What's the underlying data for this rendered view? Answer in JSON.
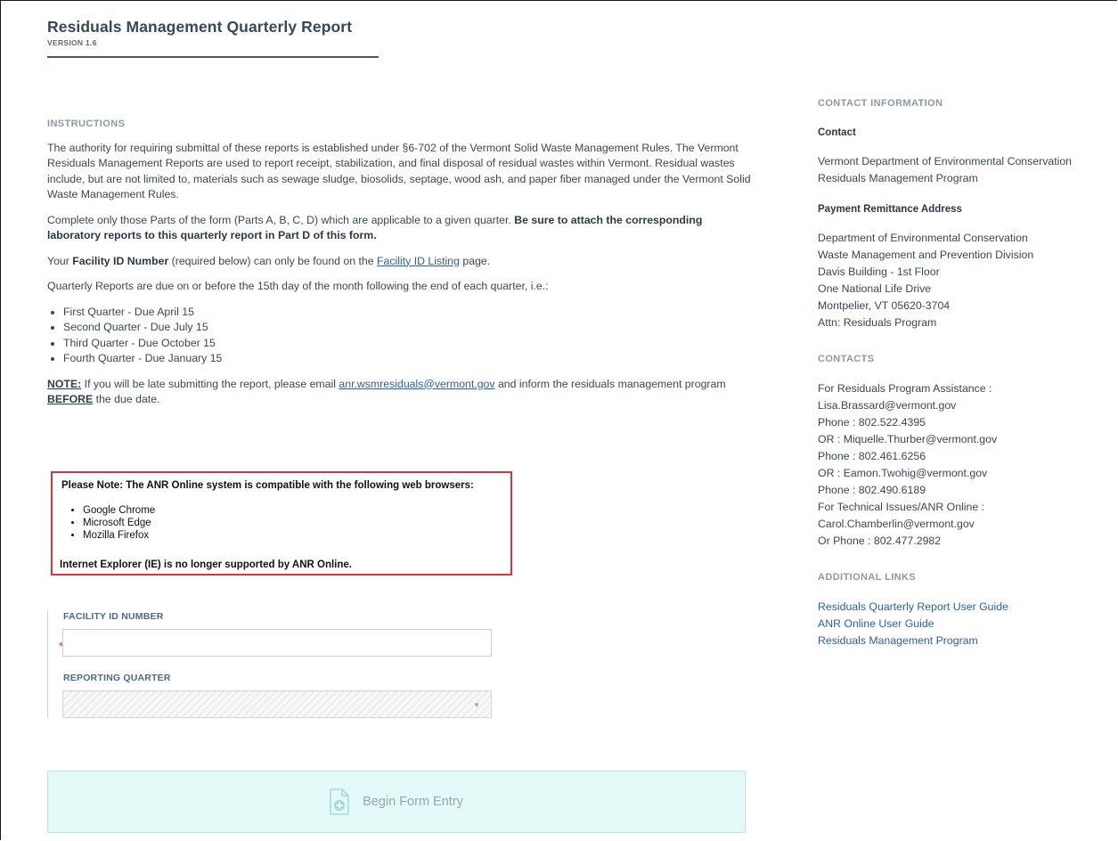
{
  "header": {
    "title": "Residuals Management Quarterly Report",
    "version": "VERSION 1.6"
  },
  "instructions": {
    "heading": "INSTRUCTIONS",
    "para1": "The authority for requiring submittal of these reports is established under §6-702 of the Vermont Solid Waste Management Rules. The Vermont Residuals Management Reports are used to report receipt, stabilization, and final disposal of residual wastes within Vermont. Residual wastes include, but are not limited to, materials such as sewage sludge, biosolids, septage, wood ash, and paper fiber managed under the Vermont Solid Waste Management Rules.",
    "para2_text": "Complete only those Parts of the form (Parts A, B, C, D) which are applicable to a given quarter. ",
    "para2_bold": "Be sure to attach the corresponding laboratory reports to this quarterly report in Part D of this form.",
    "para3_pre": "Your ",
    "para3_bold": "Facility ID Number",
    "para3_mid": " (required below) can only be found on the ",
    "para3_link": "Facility ID Listing",
    "para3_post": " page.",
    "para4": "Quarterly Reports are due on or before the 15th day of the month following the end of each quarter, i.e.:",
    "due_dates": [
      "First Quarter - Due April 15",
      "Second Quarter - Due July 15",
      "Third Quarter - Due October 15",
      "Fourth Quarter - Due January 15"
    ],
    "note_label": "NOTE:",
    "note_pre": " If you will be late submitting the report, please email ",
    "note_email": "anr.wsmresiduals@vermont.gov",
    "note_mid": " and inform the residuals management program ",
    "note_before": "BEFORE",
    "note_post": " the due date."
  },
  "browser_notice": {
    "title": "Please Note: The ANR Online system is compatible with the following web browsers:",
    "browsers": [
      "Google Chrome",
      "Microsoft Edge",
      "Mozilla Firefox"
    ],
    "footer": "Internet Explorer (IE) is no longer supported by ANR Online."
  },
  "form": {
    "facility_label": "FACILITY ID NUMBER",
    "facility_value": "",
    "required_mark": "*",
    "quarter_label": "REPORTING QUARTER",
    "begin_label": "Begin Form Entry"
  },
  "sidebar": {
    "contact_info_heading": "CONTACT INFORMATION",
    "contact_heading": "Contact",
    "contact_lines": [
      "Vermont Department of Environmental Conservation",
      "Residuals Management Program"
    ],
    "payment_heading": "Payment Remittance Address",
    "payment_lines": [
      "Department of Environmental Conservation",
      "Waste Management and Prevention Division",
      "Davis Building - 1st Floor",
      "One National Life Drive",
      "Montpelier, VT 05620-3704",
      "Attn: Residuals Program"
    ],
    "contacts_heading": "CONTACTS",
    "contacts_lines": [
      "For Residuals Program Assistance :",
      "Lisa.Brassard@vermont.gov",
      "Phone : 802.522.4395",
      "OR : Miquelle.Thurber@vermont.gov",
      "Phone : 802.461.6256",
      "OR : Eamon.Twohig@vermont.gov",
      "Phone : 802.490.6189",
      "For Technical Issues/ANR Online :",
      "Carol.Chamberlin@vermont.gov",
      "Or Phone : 802.477.2982"
    ],
    "links_heading": "ADDITIONAL LINKS",
    "links": [
      "Residuals Quarterly Report User Guide",
      "ANR Online User Guide",
      "Residuals Management Program"
    ]
  }
}
